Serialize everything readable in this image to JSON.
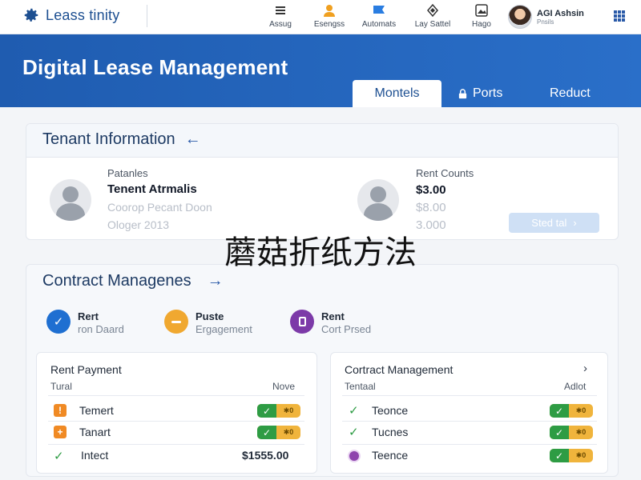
{
  "app": {
    "logo_text": "Leass tinity"
  },
  "top_nav": [
    {
      "label": "Assug",
      "icon": "hamburger-icon"
    },
    {
      "label": "Esengss",
      "icon": "person-icon"
    },
    {
      "label": "Automats",
      "icon": "flag-icon"
    },
    {
      "label": "Lay Sattel",
      "icon": "diamond-icon"
    },
    {
      "label": "Hago",
      "icon": "image-icon"
    }
  ],
  "user": {
    "name": "AGI Ashsin",
    "role": "Pnsils"
  },
  "hero": {
    "title": "Digital Lease Management",
    "tabs": [
      {
        "label": "Montels",
        "active": true
      },
      {
        "label": "Ports",
        "icon": "lock-icon"
      },
      {
        "label": "Reduct"
      }
    ]
  },
  "tenant": {
    "title": "Tenant Information",
    "left": {
      "label": "Patanles",
      "name": "Tenent Atrmalis",
      "line1": "Coorop Pecant Doon",
      "line2": "Ologer 2013"
    },
    "right": {
      "label": "Rent Counts",
      "amount1": "$3.00",
      "amount2": "$8.00",
      "amount3": "3.000"
    },
    "details_button": "Sted tal"
  },
  "overlay_text": "蘑菇折纸方法",
  "contract": {
    "title": "Contract Managenes",
    "statuses": [
      {
        "title": "Rert",
        "sub": "ron Daard",
        "color": "#1f6fd1",
        "icon": "check-icon"
      },
      {
        "title": "Puste",
        "sub": "Ergagement",
        "color": "#f0a830",
        "icon": "minus-icon"
      },
      {
        "title": "Rent",
        "sub": "Cort Prsed",
        "color": "#7c3aa8",
        "icon": "document-icon"
      }
    ],
    "rent_payment": {
      "title": "Rent Payment",
      "col_left": "Tural",
      "col_right": "Nove",
      "rows": [
        {
          "label": "Temert",
          "icon_color": "#f08a24"
        },
        {
          "label": "Tanart",
          "icon_color": "#f08a24"
        },
        {
          "label": "Intect",
          "value": "$1555.00"
        }
      ]
    },
    "contract_mgmt": {
      "title": "Cortract Management",
      "col_left": "Tentaal",
      "col_right": "Adlot",
      "rows": [
        {
          "label": "Teonce"
        },
        {
          "label": "Tucnes"
        },
        {
          "label": "Teence"
        }
      ]
    }
  },
  "colors": {
    "brand": "#1f5cb0",
    "success": "#2e9c44",
    "warning": "#f0b43c"
  }
}
